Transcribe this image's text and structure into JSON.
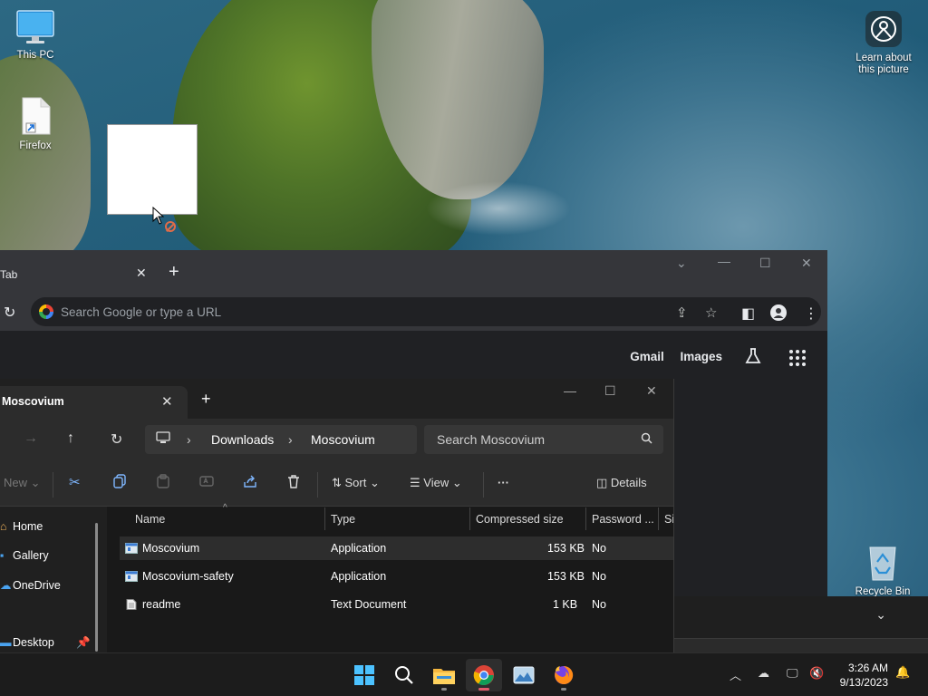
{
  "desktop": {
    "icons": [
      {
        "name": "this-pc",
        "label": "This PC"
      },
      {
        "name": "firefox",
        "label": "Firefox"
      },
      {
        "name": "learn-picture",
        "label": "Learn about this picture"
      },
      {
        "name": "recycle-bin",
        "label": "Recycle Bin"
      }
    ]
  },
  "chrome": {
    "tab_label": "Tab",
    "tab_close": "✕",
    "new_tab": "+",
    "omnibox_placeholder": "Search Google or type a URL",
    "links": [
      "Gmail",
      "Images"
    ]
  },
  "explorer": {
    "tab_label": "Moscovium",
    "tab_close": "✕",
    "new_tab": "+",
    "breadcrumb": [
      "Downloads",
      "Moscovium"
    ],
    "search_placeholder": "Search Moscovium",
    "commands": {
      "new": "New",
      "sort": "Sort",
      "view": "View",
      "more": "···",
      "details": "Details"
    },
    "sidebar": [
      "Home",
      "Gallery",
      "OneDrive",
      "Desktop"
    ],
    "columns": [
      "Name",
      "Type",
      "Compressed size",
      "Password ...",
      "Si"
    ],
    "files": [
      {
        "name": "Moscovium",
        "type": "Application",
        "size": "153 KB",
        "password": "No",
        "icon": "app-icon"
      },
      {
        "name": "Moscovium-safety",
        "type": "Application",
        "size": "153 KB",
        "password": "No",
        "icon": "app-icon"
      },
      {
        "name": "readme",
        "type": "Text Document",
        "size": "1 KB",
        "password": "No",
        "icon": "text-file-icon"
      }
    ]
  },
  "taskbar": {
    "time": "3:26 AM",
    "date": "9/13/2023",
    "apps": [
      "start",
      "search",
      "file-explorer",
      "chrome",
      "photos",
      "firefox"
    ]
  },
  "colors": {
    "accent_blue": "#4aa3f0",
    "taskbar_active_indicator": "#e05a6a",
    "chrome_bg": "#202124",
    "explorer_bg": "#191919"
  }
}
